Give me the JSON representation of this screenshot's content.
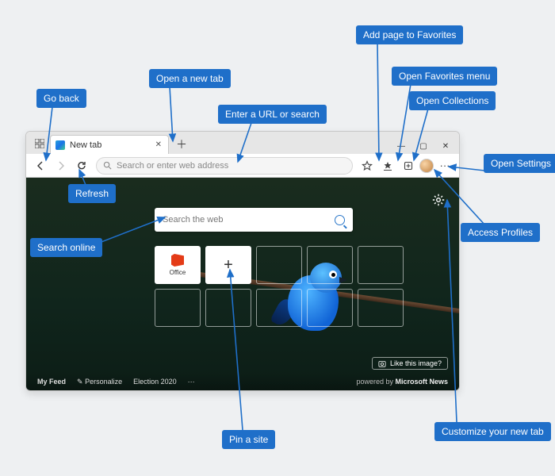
{
  "callouts": {
    "go_back": "Go back",
    "open_new_tab": "Open a new tab",
    "enter_url": "Enter a URL or search",
    "add_favorites": "Add page to Favorites",
    "open_favorites_menu": "Open Favorites menu",
    "open_collections": "Open Collections",
    "open_settings": "Open Settings",
    "access_profiles": "Access Profiles",
    "refresh": "Refresh",
    "search_online": "Search online",
    "pin_site": "Pin a site",
    "customize_tab": "Customize your new tab"
  },
  "tab": {
    "title": "New tab"
  },
  "toolbar": {
    "address_placeholder": "Search or enter web address"
  },
  "ntp": {
    "search_placeholder": "Search the web",
    "office_label": "Office",
    "like_image": "Like this image?"
  },
  "footer": {
    "my_feed": "My Feed",
    "personalize": "Personalize",
    "election": "Election 2020",
    "more": "···",
    "powered_prefix": "powered by",
    "powered_brand": "Microsoft News"
  }
}
